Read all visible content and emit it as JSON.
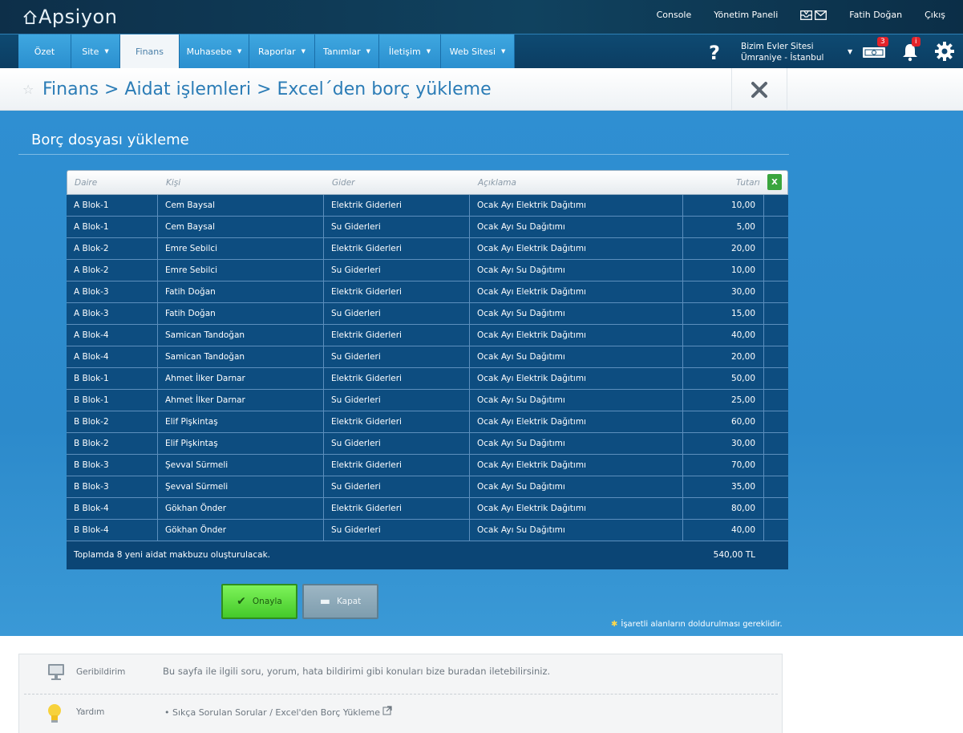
{
  "app": {
    "logo": "Apsiyon"
  },
  "topbar": {
    "links": [
      "Console",
      "Yönetim Paneli"
    ],
    "user": "Fatih Doğan",
    "logout": "Çıkış"
  },
  "nav": {
    "tabs": [
      {
        "label": "Özet",
        "caret": false
      },
      {
        "label": "Site",
        "caret": true
      },
      {
        "label": "Finans",
        "caret": false,
        "active": true
      },
      {
        "label": "Muhasebe",
        "caret": true
      },
      {
        "label": "Raporlar",
        "caret": true
      },
      {
        "label": "Tanımlar",
        "caret": true
      },
      {
        "label": "İletişim",
        "caret": true
      },
      {
        "label": "Web Sitesi",
        "caret": true
      }
    ],
    "help": "?",
    "site_name": "Bizim Evler Sitesi",
    "site_location": "Ümraniye - İstanbul",
    "money_badge": "3",
    "bell_badge": "i"
  },
  "breadcrumb": {
    "text": "Finans > Aidat işlemleri > Excel´den borç yükleme"
  },
  "section": {
    "title": "Borç dosyası yükleme"
  },
  "table": {
    "headers": {
      "daire": "Daire",
      "kisi": "Kişi",
      "gider": "Gider",
      "aciklama": "Açıklama",
      "tutar": "Tutarı"
    },
    "excel_label": "X",
    "rows": [
      [
        "A Blok-1",
        "Cem Baysal",
        "Elektrik Giderleri",
        "Ocak Ayı Elektrik Dağıtımı",
        "10,00"
      ],
      [
        "A Blok-1",
        "Cem Baysal",
        "Su Giderleri",
        "Ocak Ayı Su Dağıtımı",
        "5,00"
      ],
      [
        "A Blok-2",
        "Emre Sebilci",
        "Elektrik Giderleri",
        "Ocak Ayı Elektrik Dağıtımı",
        "20,00"
      ],
      [
        "A Blok-2",
        "Emre Sebilci",
        "Su Giderleri",
        "Ocak Ayı Su Dağıtımı",
        "10,00"
      ],
      [
        "A Blok-3",
        "Fatih Doğan",
        "Elektrik Giderleri",
        "Ocak Ayı Elektrik Dağıtımı",
        "30,00"
      ],
      [
        "A Blok-3",
        "Fatih Doğan",
        "Su Giderleri",
        "Ocak Ayı Su Dağıtımı",
        "15,00"
      ],
      [
        "A Blok-4",
        "Samican Tandoğan",
        "Elektrik Giderleri",
        "Ocak Ayı Elektrik Dağıtımı",
        "40,00"
      ],
      [
        "A Blok-4",
        "Samican Tandoğan",
        "Su Giderleri",
        "Ocak Ayı Su Dağıtımı",
        "20,00"
      ],
      [
        "B Blok-1",
        "Ahmet İlker Darnar",
        "Elektrik Giderleri",
        "Ocak Ayı Elektrik Dağıtımı",
        "50,00"
      ],
      [
        "B Blok-1",
        "Ahmet İlker Darnar",
        "Su Giderleri",
        "Ocak Ayı Su Dağıtımı",
        "25,00"
      ],
      [
        "B Blok-2",
        "Elif Pişkintaş",
        "Elektrik Giderleri",
        "Ocak Ayı Elektrik Dağıtımı",
        "60,00"
      ],
      [
        "B Blok-2",
        "Elif Pişkintaş",
        "Su Giderleri",
        "Ocak Ayı Su Dağıtımı",
        "30,00"
      ],
      [
        "B Blok-3",
        "Şevval Sürmeli",
        "Elektrik Giderleri",
        "Ocak Ayı Elektrik Dağıtımı",
        "70,00"
      ],
      [
        "B Blok-3",
        "Şevval Sürmeli",
        "Su Giderleri",
        "Ocak Ayı Su Dağıtımı",
        "35,00"
      ],
      [
        "B Blok-4",
        "Gökhan Önder",
        "Elektrik Giderleri",
        "Ocak Ayı Elektrik Dağıtımı",
        "80,00"
      ],
      [
        "B Blok-4",
        "Gökhan Önder",
        "Su Giderleri",
        "Ocak Ayı Su Dağıtımı",
        "40,00"
      ]
    ],
    "footer_text": "Toplamda 8 yeni aidat makbuzu oluşturulacak.",
    "total": "540,00 TL"
  },
  "buttons": {
    "confirm": "Onayla",
    "close": "Kapat"
  },
  "required_note": "İşaretli alanların doldurulması gereklidir.",
  "footer": {
    "feedback_label": "Geribildirim",
    "feedback_text": "Bu sayfa ile ilgili soru, yorum, hata bildirimi gibi konuları bize buradan iletebilirsiniz.",
    "help_label": "Yardım",
    "help_link": "Sıkça Sorulan Sorular / Excel'den Borç Yükleme"
  },
  "colors": {
    "accent": "#2f8fd0",
    "nav_dark": "#0e4a72",
    "table_bg": "#0d4d80",
    "confirm": "#5fdc3c"
  }
}
